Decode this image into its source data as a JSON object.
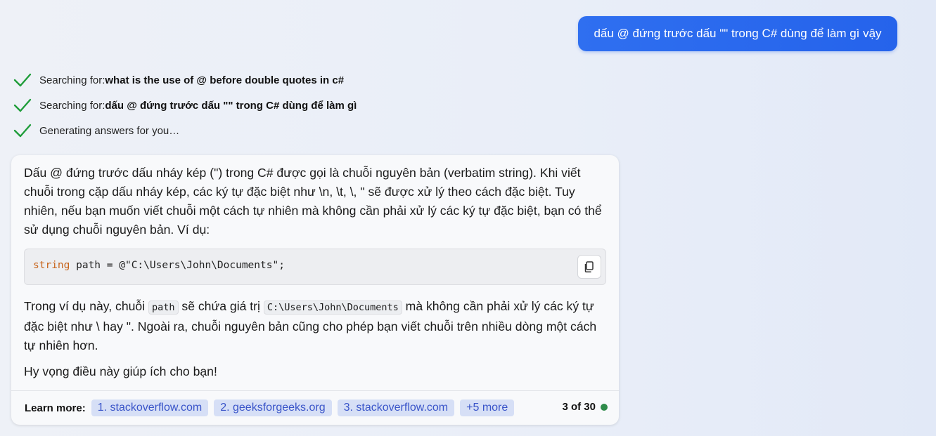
{
  "user_message": "dấu @ đứng trước dấu \"\" trong C# dùng để làm gì vậy",
  "status": [
    {
      "prefix": "Searching for: ",
      "query": "what is the use of @ before double quotes in c#"
    },
    {
      "prefix": "Searching for: ",
      "query": "dấu @ đứng trước dấu \"\" trong C# dùng để làm gì"
    },
    {
      "prefix": "Generating answers for you…",
      "query": ""
    }
  ],
  "answer": {
    "intro": "Dấu @ đứng trước dấu nháy kép (\") trong C# được gọi là chuỗi nguyên bản (verbatim string). Khi viết chuỗi trong cặp dấu nháy kép, các ký tự đặc biệt như \\n, \\t, \\, \" sẽ được xử lý theo cách đặc biệt. Tuy nhiên, nếu bạn muốn viết chuỗi một cách tự nhiên mà không cần phải xử lý các ký tự đặc biệt, bạn có thể sử dụng chuỗi nguyên bản. Ví dụ:",
    "code": {
      "keyword": "string",
      "rest": " path = @\"C:\\Users\\John\\Documents\";"
    },
    "explain": {
      "part1": "Trong ví dụ này, chuỗi ",
      "code1": "path",
      "part2": " sẽ chứa giá trị ",
      "code2": "C:\\Users\\John\\Documents",
      "part3": " mà không cần phải xử lý các ký tự đặc biệt như \\ hay \". Ngoài ra, chuỗi nguyên bản cũng cho phép bạn viết chuỗi trên nhiều dòng một cách tự nhiên hơn."
    },
    "closing": "Hy vọng điều này giúp ích cho bạn!"
  },
  "learn_more": {
    "label": "Learn more:",
    "sources": [
      "1. stackoverflow.com",
      "2. geeksforgeeks.org",
      "3. stackoverflow.com"
    ],
    "more": "+5 more",
    "counter": "3 of 30"
  },
  "colors": {
    "user_bubble": "#2563eb",
    "check": "#1f9d3a",
    "chip_bg": "#d6dff6",
    "chip_text": "#3a55c9",
    "keyword": "#c8641b",
    "status_dot": "#2e8b4a"
  },
  "icons": {
    "check": "checkmark-icon",
    "copy": "copy-icon"
  }
}
